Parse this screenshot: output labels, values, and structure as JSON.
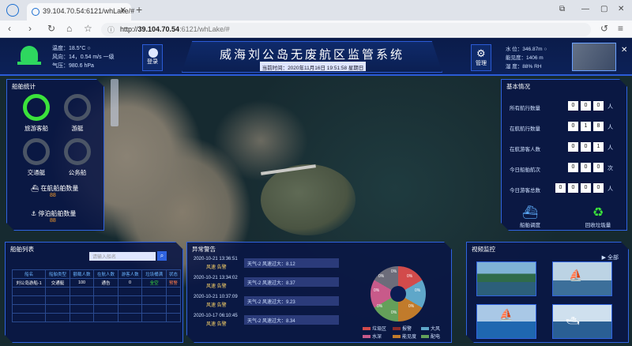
{
  "browser": {
    "tab_title": "39.104.70.54:6121/whLake/#",
    "url_prefix": "http://",
    "url_host": "39.104.70.54",
    "url_path": ":6121/whLake/#"
  },
  "header": {
    "title": "威海刘公岛无废航区监管系统",
    "time_label": "当前时间：2020年11月16日 19:51:58 星期日",
    "weather": [
      "温度：18.5°C ○",
      "风向：14，0.54 m/s 一级",
      "气压：980.6 hPa"
    ],
    "login_label": "登录",
    "admin_label": "管理",
    "right_stats": [
      "水 位：346.87m ○",
      "能见度：1406 m",
      "湿 度：88% RH"
    ]
  },
  "ship_stats": {
    "title": "船舶统计",
    "gauges": [
      {
        "label": "旅游客船",
        "color": "#3be33b"
      },
      {
        "label": "游艇",
        "color": "#4b5566"
      },
      {
        "label": "交通艇",
        "color": "#4b5566"
      },
      {
        "label": "公务船",
        "color": "#4b5566"
      }
    ],
    "in_service": {
      "label": "在航船舶数量",
      "value": "88"
    },
    "docked": {
      "label": "停泊船舶数量",
      "value": "88"
    }
  },
  "basic_info": {
    "title": "基本情况",
    "rows": [
      {
        "label": "所有航行数量",
        "digits": [
          "0",
          "0",
          "0"
        ],
        "unit": "人"
      },
      {
        "label": "在航航行数量",
        "digits": [
          "0",
          "1",
          "8"
        ],
        "unit": "人"
      },
      {
        "label": "在航游客人数",
        "digits": [
          "0",
          "0",
          "1"
        ],
        "unit": "人"
      },
      {
        "label": "今日船舶航次",
        "digits": [
          "0",
          "0",
          "0"
        ],
        "unit": "次"
      },
      {
        "label": "今日游客总数",
        "digits": [
          "0",
          "0",
          "0",
          "0"
        ],
        "unit": "人"
      }
    ],
    "bottom_icons": [
      {
        "label": "船舶调度",
        "icon": "ship-icon"
      },
      {
        "label": "回收垃圾量",
        "icon": "recycle-icon"
      }
    ]
  },
  "ship_list": {
    "title": "船舶列表",
    "search_placeholder": "请输入船名",
    "columns": [
      "船名",
      "船舶类型",
      "额载人数",
      "在航人数",
      "游客人数",
      "垃圾桶满",
      "状态"
    ],
    "rows": [
      [
        "刘公岛游船-1",
        "交通艇",
        "100",
        "通告",
        "0",
        "全空",
        "预警"
      ]
    ]
  },
  "alerts": {
    "title": "异常警告",
    "items": [
      {
        "time": "2020-10-21 13:36:51",
        "tag": "风速 告警",
        "text": "天气-2 风速过大：8.12"
      },
      {
        "time": "2020-10-21 13:34:02",
        "tag": "风速 告警",
        "text": "天气-2 风速过大：8.37"
      },
      {
        "time": "2020-10-21 10:37:09",
        "tag": "风速 告警",
        "text": "天气-2 风速过大：9.23"
      },
      {
        "time": "2020-10-17 06:10:45",
        "tag": "风速 告警",
        "text": "天气-2 风速过大：8.34"
      }
    ],
    "pie_pcts": [
      "0%",
      "0%",
      "0%",
      "0%",
      "0%",
      "0%",
      "0%",
      "0%"
    ],
    "legend": [
      {
        "label": "垃圾区",
        "color": "#d24b4b"
      },
      {
        "label": "报警",
        "color": "#8a2b2b"
      },
      {
        "label": "大风",
        "color": "#5fa7c9"
      },
      {
        "label": "水深",
        "color": "#c85a8a"
      },
      {
        "label": "能见度",
        "color": "#c17b2b"
      },
      {
        "label": "配电",
        "color": "#64a05a"
      }
    ]
  },
  "video": {
    "title": "视频监控",
    "more_label": "全部"
  }
}
